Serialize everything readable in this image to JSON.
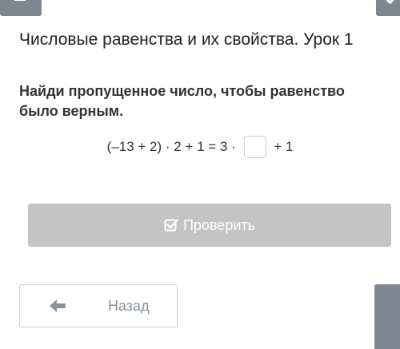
{
  "header": {
    "lesson_title": "Числовые равенства и их свойства. Урок 1"
  },
  "task": {
    "instruction": "Найди пропущенное число, чтобы равенство было верным.",
    "equation_left": "(–13 + 2) · 2 + 1 = 3 · ",
    "equation_right": " + 1",
    "answer_value": ""
  },
  "buttons": {
    "check_label": "Проверить",
    "back_label": "Назад"
  },
  "icons": {
    "check": "checkbox-check-icon",
    "back": "arrow-left-icon",
    "menu": "menu-icon",
    "collapse": "chevron-down-icon"
  },
  "colors": {
    "check_button_bg": "#c4c4c4",
    "top_buttons_bg": "#7d8791",
    "back_text": "#8a949c"
  }
}
